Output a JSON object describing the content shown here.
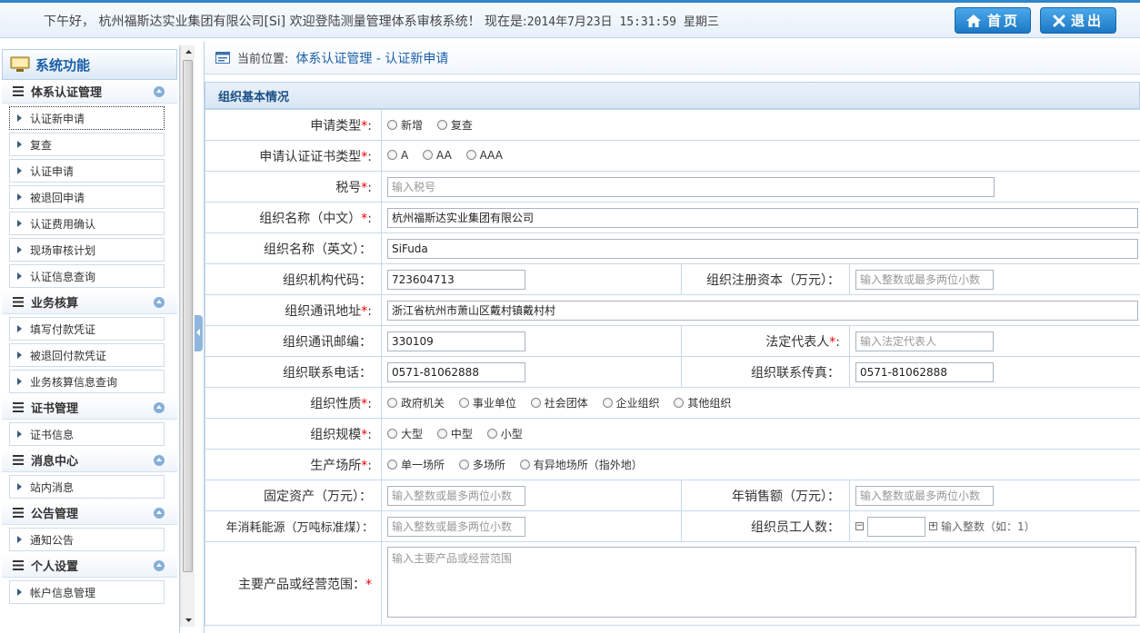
{
  "header": {
    "greeting": "下午好， 杭州福斯达实业集团有限公司[Si] 欢迎登陆测量管理体系审核系统！ 现在是:",
    "datetime": "2014年7月23日 15:31:59 星期三",
    "home_label": "首页",
    "exit_label": "退出"
  },
  "sidebar": {
    "title": "系统功能",
    "groups": [
      {
        "label": "体系认证管理",
        "items": [
          "认证新申请",
          "复查",
          "认证申请",
          "被退回申请",
          "认证费用确认",
          "现场审核计划",
          "认证信息查询"
        ]
      },
      {
        "label": "业务核算",
        "items": [
          "填写付款凭证",
          "被退回付款凭证",
          "业务核算信息查询"
        ]
      },
      {
        "label": "证书管理",
        "items": [
          "证书信息"
        ]
      },
      {
        "label": "消息中心",
        "items": [
          "站内消息"
        ]
      },
      {
        "label": "公告管理",
        "items": [
          "通知公告"
        ]
      },
      {
        "label": "个人设置",
        "items": [
          "帐户信息管理"
        ]
      }
    ]
  },
  "breadcrumb": {
    "label": "当前位置:",
    "value": "体系认证管理 - 认证新申请"
  },
  "section_title": "组织基本情况",
  "form": {
    "apply_type": {
      "label": "申请类型",
      "options": [
        "新增",
        "复查"
      ]
    },
    "cert_type": {
      "label": "申请认证证书类型",
      "options": [
        "A",
        "AA",
        "AAA"
      ]
    },
    "tax_no": {
      "label": "税号",
      "placeholder": "输入税号",
      "value": ""
    },
    "org_name_cn": {
      "label": "组织名称（中文）",
      "value": "杭州福斯达实业集团有限公司"
    },
    "org_name_en": {
      "label": "组织名称（英文）：",
      "value": "SiFuda"
    },
    "org_code": {
      "label": "组织机构代码：",
      "value": "723604713"
    },
    "reg_capital": {
      "label": "组织注册资本（万元）：",
      "placeholder": "输入整数或最多两位小数"
    },
    "address": {
      "label": "组织通讯地址",
      "value": "浙江省杭州市萧山区戴村镇戴村村"
    },
    "postcode": {
      "label": "组织通讯邮编：",
      "value": "330109"
    },
    "legal_rep": {
      "label": "法定代表人",
      "placeholder": "输入法定代表人"
    },
    "phone": {
      "label": "组织联系电话：",
      "value": "0571-81062888"
    },
    "fax": {
      "label": "组织联系传真：",
      "value": "0571-81062888"
    },
    "nature": {
      "label": "组织性质",
      "options": [
        "政府机关",
        "事业单位",
        "社会团体",
        "企业组织",
        "其他组织"
      ]
    },
    "scale": {
      "label": "组织规模",
      "options": [
        "大型",
        "中型",
        "小型"
      ]
    },
    "site": {
      "label": "生产场所",
      "options": [
        "单一场所",
        "多场所",
        "有异地场所（指外地）"
      ]
    },
    "fixed_assets": {
      "label": "固定资产（万元）：",
      "placeholder": "输入整数或最多两位小数"
    },
    "annual_sales": {
      "label": "年销售额（万元）：",
      "placeholder": "输入整数或最多两位小数"
    },
    "energy": {
      "label": "年消耗能源（万吨标准煤）：",
      "placeholder": "输入整数或最多两位小数"
    },
    "staff": {
      "label": "组织员工人数：",
      "hint": "输入整数（如：1）"
    },
    "products": {
      "label": "主要产品或经营范围：",
      "placeholder": "输入主要产品或经营范围"
    }
  }
}
